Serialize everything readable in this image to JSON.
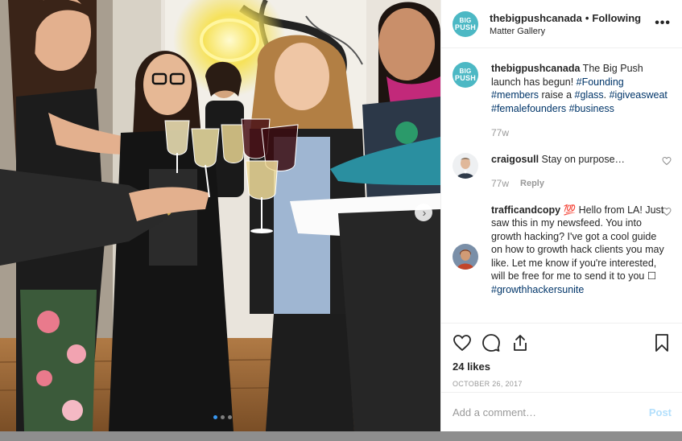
{
  "header": {
    "avatar_line1": "BIG",
    "avatar_line2": "PUSH",
    "username": "thebigpushcanada",
    "separator": "•",
    "follow_status": "Following",
    "location": "Matter Gallery",
    "more_icon": "more-horizontal-icon"
  },
  "caption": {
    "username": "thebigpushcanada",
    "text_1": " The Big Push launch has begun! ",
    "tag_1": "#Founding",
    "tag_2": "#members",
    "text_2": " raise a ",
    "tag_3": "#glass",
    "text_3": ". ",
    "tag_4": "#igiveasweat",
    "tag_5": "#femalefounders",
    "tag_6": "#business",
    "time": "77w"
  },
  "comments": [
    {
      "username": "craigosull",
      "text": " Stay on purpose…",
      "time": "77w",
      "reply_label": "Reply"
    },
    {
      "username": "trafficandcopy",
      "emoji": " 💯 ",
      "text": "Hello from LA! Just saw this in my newsfeed. You into growth hacking? I've got a cool guide on how to growth hack clients you may like. Let me know if you're interested, will be free for me to send it to you ☐ ",
      "tag": "#growthhackersunite"
    }
  ],
  "actions": {
    "like_icon": "heart-icon",
    "comment_icon": "comment-icon",
    "share_icon": "share-icon",
    "save_icon": "bookmark-icon"
  },
  "likes": "24 likes",
  "date": "OCTOBER 26, 2017",
  "add_comment": {
    "placeholder": "Add a comment…",
    "post_label": "Post"
  },
  "carousel": {
    "total": 3,
    "active_index": 0,
    "next_icon": "chevron-right-icon"
  },
  "colors": {
    "brand_teal": "#4cb8c4",
    "link_blue": "#003569",
    "post_disabled": "#b2dffc",
    "active_dot": "#3897f0"
  }
}
